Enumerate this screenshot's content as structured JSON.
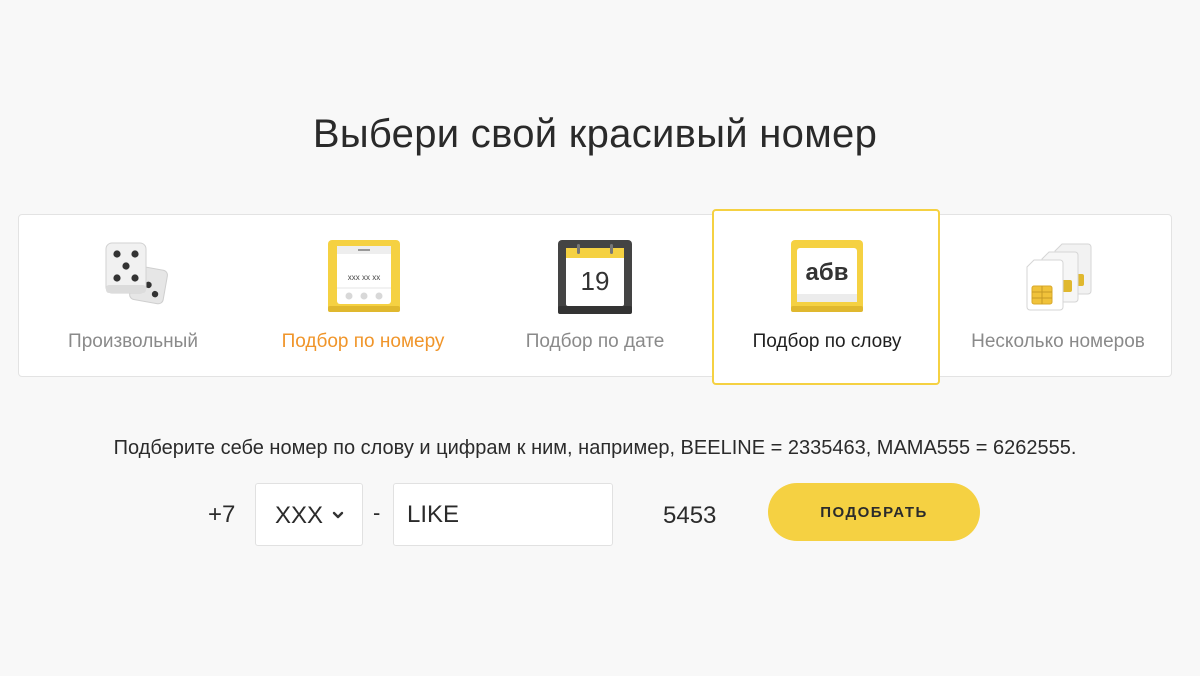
{
  "title": "Выбери свой красивый номер",
  "tabs": [
    {
      "label": "Произвольный",
      "icon": "dice-icon",
      "state": "default"
    },
    {
      "label": "Подбор по номеру",
      "icon": "phone-number-icon",
      "state": "highlight",
      "icon_text": "xxx xx xx"
    },
    {
      "label": "Подбор по дате",
      "icon": "calendar-icon",
      "state": "default",
      "icon_text": "19"
    },
    {
      "label": "Подбор по слову",
      "icon": "letters-icon",
      "state": "active",
      "icon_text": "абв"
    },
    {
      "label": "Несколько номеров",
      "icon": "sim-cards-icon",
      "state": "default"
    }
  ],
  "hint": "Подберите себе номер по слову и цифрам к ним, например, BEELINE = 2335463, MAMA555 = 6262555.",
  "form": {
    "prefix": "+7",
    "code_value": "XXX",
    "dash": "-",
    "word_value": "LIKE",
    "digits": "5453",
    "submit_label": "ПОДОБРАТЬ"
  },
  "colors": {
    "accent": "#f5d142",
    "orange": "#f0952a",
    "background": "#f8f8f8"
  }
}
